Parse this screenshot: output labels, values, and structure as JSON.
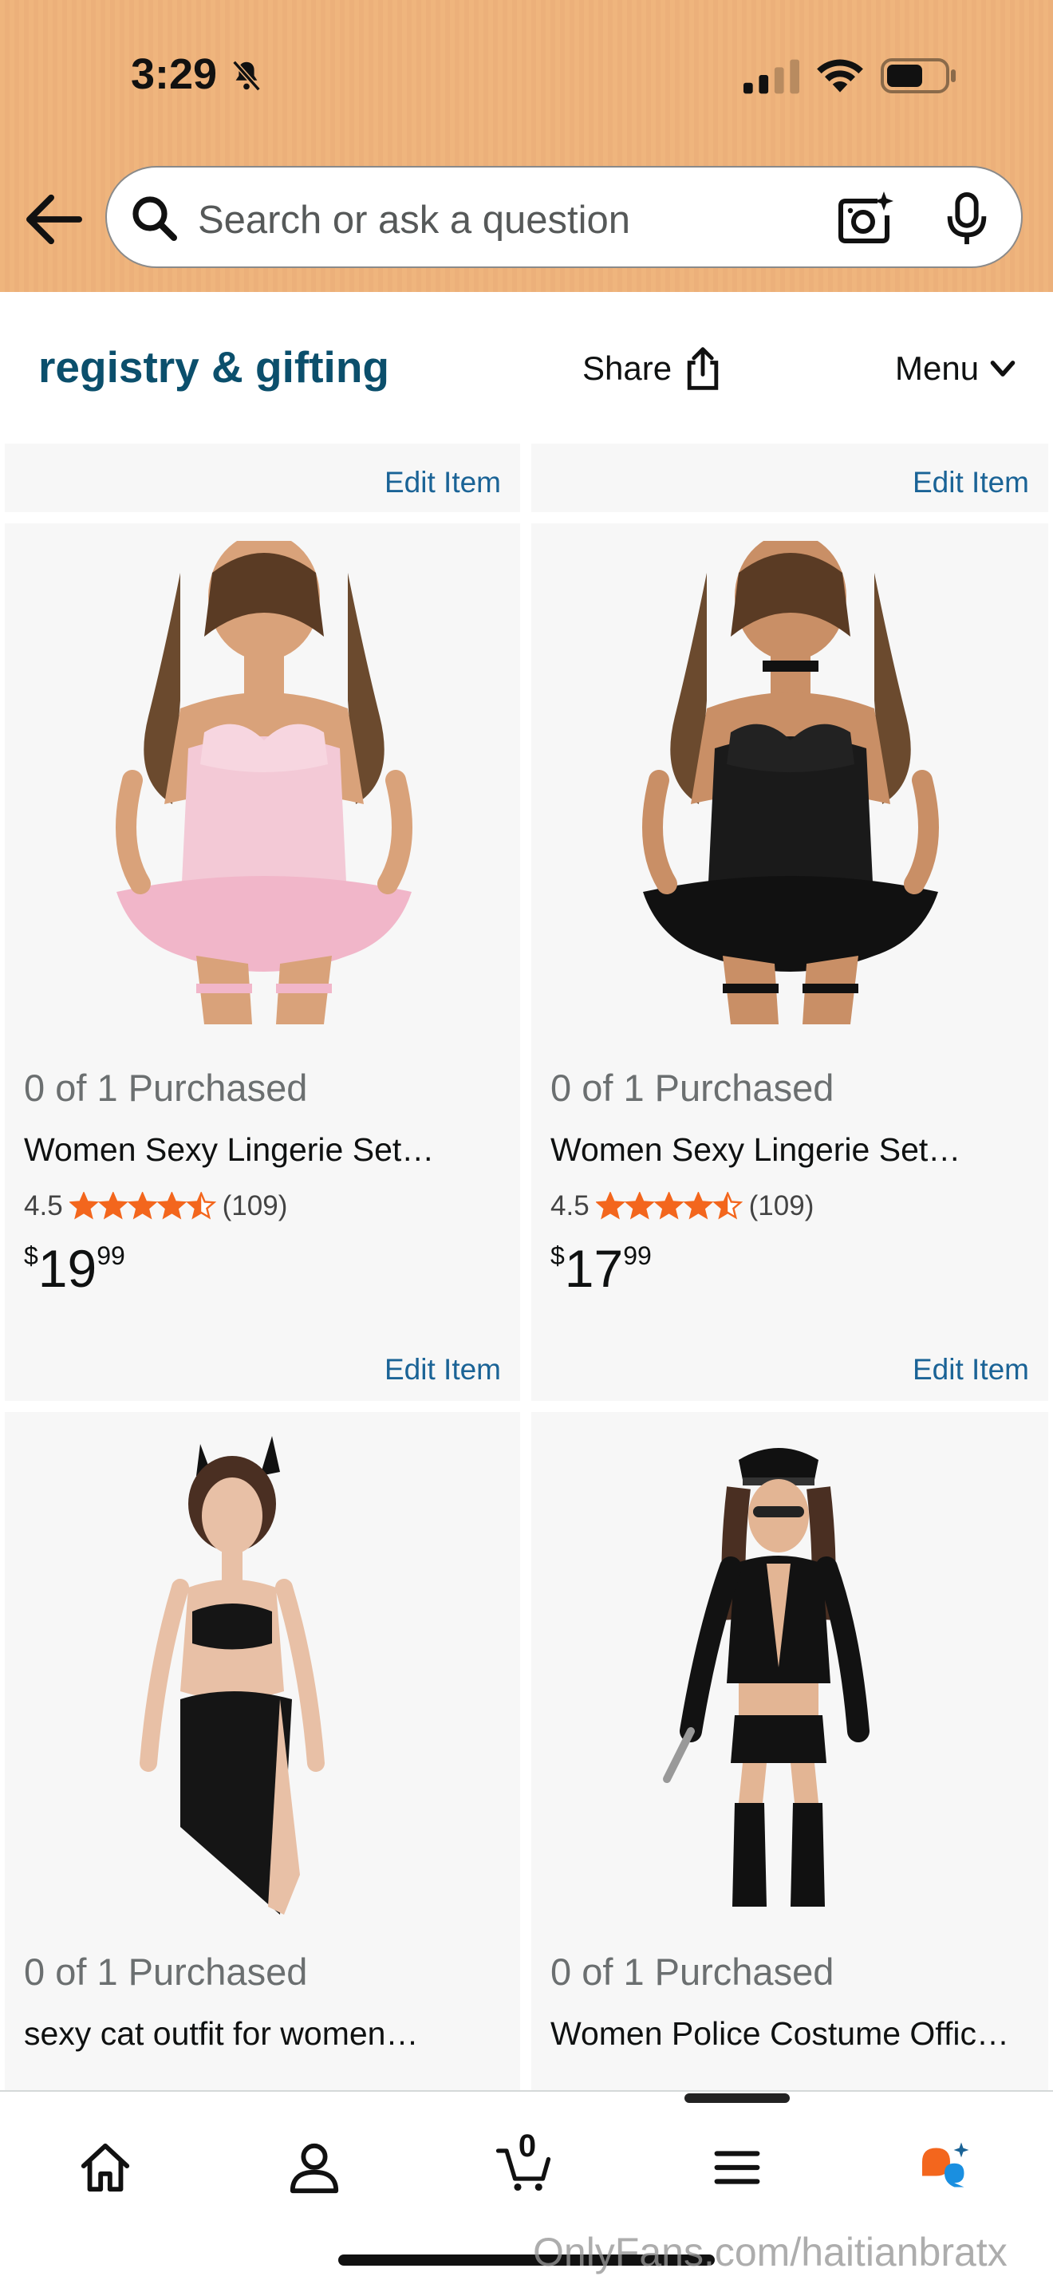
{
  "status_bar": {
    "time": "3:29"
  },
  "search": {
    "placeholder": "Search or ask a question"
  },
  "registry": {
    "title": "registry & gifting",
    "share_label": "Share",
    "menu_label": "Menu"
  },
  "top_edit_links": [
    "Edit Item",
    "Edit Item"
  ],
  "products": [
    {
      "purchased": "0 of 1 Purchased",
      "title": "Women Sexy Lingerie Set…",
      "rating": "4.5",
      "stars": 4.5,
      "reviews": "(109)",
      "price_symbol": "$",
      "price_whole": "19",
      "price_fraction": "99",
      "edit_label": "Edit Item",
      "image": "pink-lace-corset-lingerie"
    },
    {
      "purchased": "0 of 1 Purchased",
      "title": "Women Sexy Lingerie Set…",
      "rating": "4.5",
      "stars": 4.5,
      "reviews": "(109)",
      "price_symbol": "$",
      "price_whole": "17",
      "price_fraction": "99",
      "edit_label": "Edit Item",
      "image": "black-lace-corset-lingerie"
    },
    {
      "purchased": "0 of 1 Purchased",
      "title": "sexy cat outfit for women…",
      "image": "black-cat-outfit"
    },
    {
      "purchased": "0 of 1 Purchased",
      "title": "Women Police Costume Offic…",
      "image": "police-costume"
    }
  ],
  "bottom_nav": {
    "items": [
      {
        "name": "home",
        "icon": "home-icon"
      },
      {
        "name": "account",
        "icon": "person-icon"
      },
      {
        "name": "cart",
        "icon": "cart-icon",
        "count": "0"
      },
      {
        "name": "menu",
        "icon": "hamburger-icon"
      },
      {
        "name": "rufus",
        "icon": "chat-bubbles-icon"
      }
    ]
  },
  "watermark": "OnlyFans.com/haitianbratx",
  "colors": {
    "header_bg": "#efb57d",
    "link": "#1a6396",
    "title": "#0b4f6c",
    "star": "#f3661d",
    "card_bg": "#f7f7f7"
  }
}
